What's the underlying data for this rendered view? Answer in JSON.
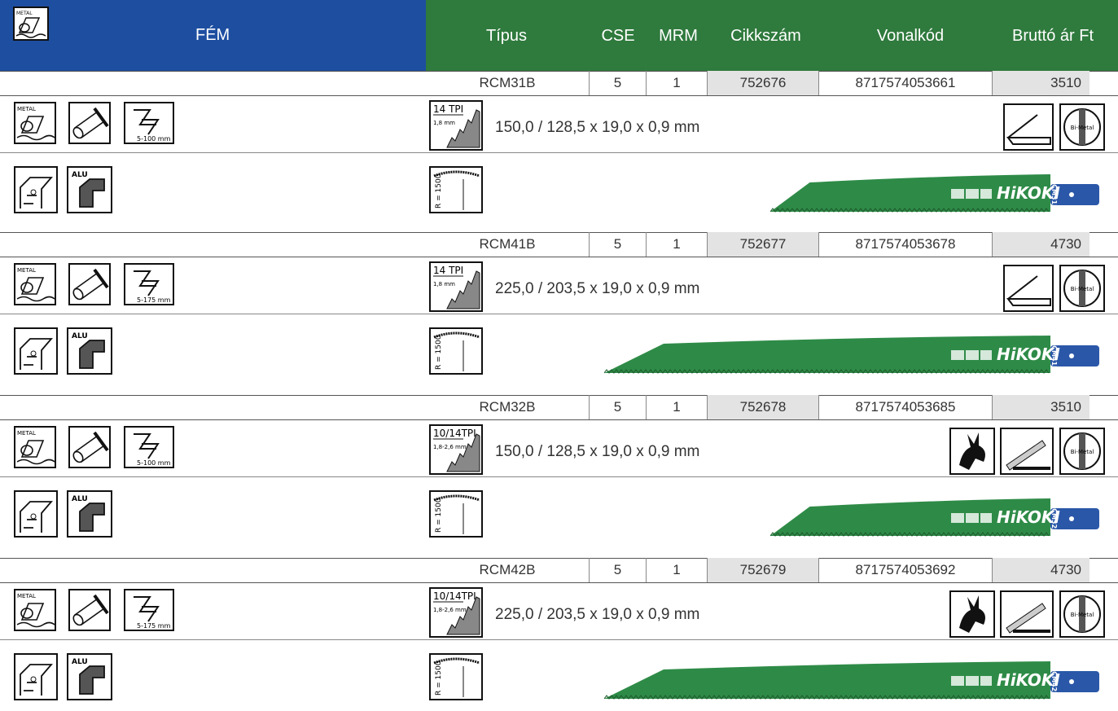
{
  "header": {
    "category": "FÉM",
    "logo_text": "METAL",
    "columns": [
      "Típus",
      "CSE",
      "MRM",
      "Cikkszám",
      "Vonalkód",
      "Bruttó ár Ft"
    ]
  },
  "colors": {
    "blue": "#1d4ea0",
    "green": "#2f7a3d",
    "blade": "#2e8b47",
    "blade_end": "#2a57a8"
  },
  "products": [
    {
      "type": "RCM31B",
      "cse": "5",
      "mrm": "1",
      "code": "752676",
      "barcode": "8717574053661",
      "price": "3510",
      "tpi": "14 TPI",
      "pitch": "1,8 mm",
      "dims": "150,0 / 128,5 x 19,0 x 0,9 mm",
      "range": "5-100 mm",
      "radius": "R = 1500",
      "blade_label": "RCM31B",
      "brand": "HiKOKI"
    },
    {
      "type": "RCM41B",
      "cse": "5",
      "mrm": "1",
      "code": "752677",
      "barcode": "8717574053678",
      "price": "4730",
      "tpi": "14 TPI",
      "pitch": "1,8 mm",
      "dims": "225,0 / 203,5 x 19,0 x 0,9 mm",
      "range": "5-175 mm",
      "radius": "R = 1500",
      "blade_label": "RCM41B",
      "brand": "HiKOKI"
    },
    {
      "type": "RCM32B",
      "cse": "5",
      "mrm": "1",
      "code": "752678",
      "barcode": "8717574053685",
      "price": "3510",
      "tpi": "10/14TPI",
      "pitch": "1,8-2,6 mm",
      "dims": "150,0 / 128,5 x 19,0 x 0,9 mm",
      "range": "5-100 mm",
      "radius": "R = 1500",
      "blade_label": "RCM32B",
      "brand": "HiKOKI"
    },
    {
      "type": "RCM42B",
      "cse": "5",
      "mrm": "1",
      "code": "752679",
      "barcode": "8717574053692",
      "price": "4730",
      "tpi": "10/14TPI",
      "pitch": "1,8-2,6 mm",
      "dims": "225,0 / 203,5 x 19,0 x 0,9 mm",
      "range": "5-175 mm",
      "radius": "R = 1500",
      "blade_label": "RCM42B",
      "brand": "HiKOKI"
    }
  ],
  "icon_labels": {
    "alu": "ALU",
    "bimetal": "Bi-Metal"
  }
}
